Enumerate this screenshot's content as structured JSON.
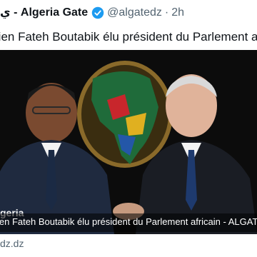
{
  "tweet": {
    "author_name": "ي - Algeria Gate",
    "handle": "@algatedz",
    "separator": "·",
    "time": "2h",
    "text": "rien Fateh Boutabik élu président du Parlement africain"
  },
  "card": {
    "caption": "ien Fateh Boutabik élu président du Parlement africain - ALGATE",
    "watermark": "geria",
    "domain": "dz.dz"
  },
  "colors": {
    "verified": "#1d9bf0",
    "background": "#0c0c0c",
    "map_frame": "#8a6a2a"
  },
  "icons": {
    "verified": "verified-badge-icon"
  }
}
